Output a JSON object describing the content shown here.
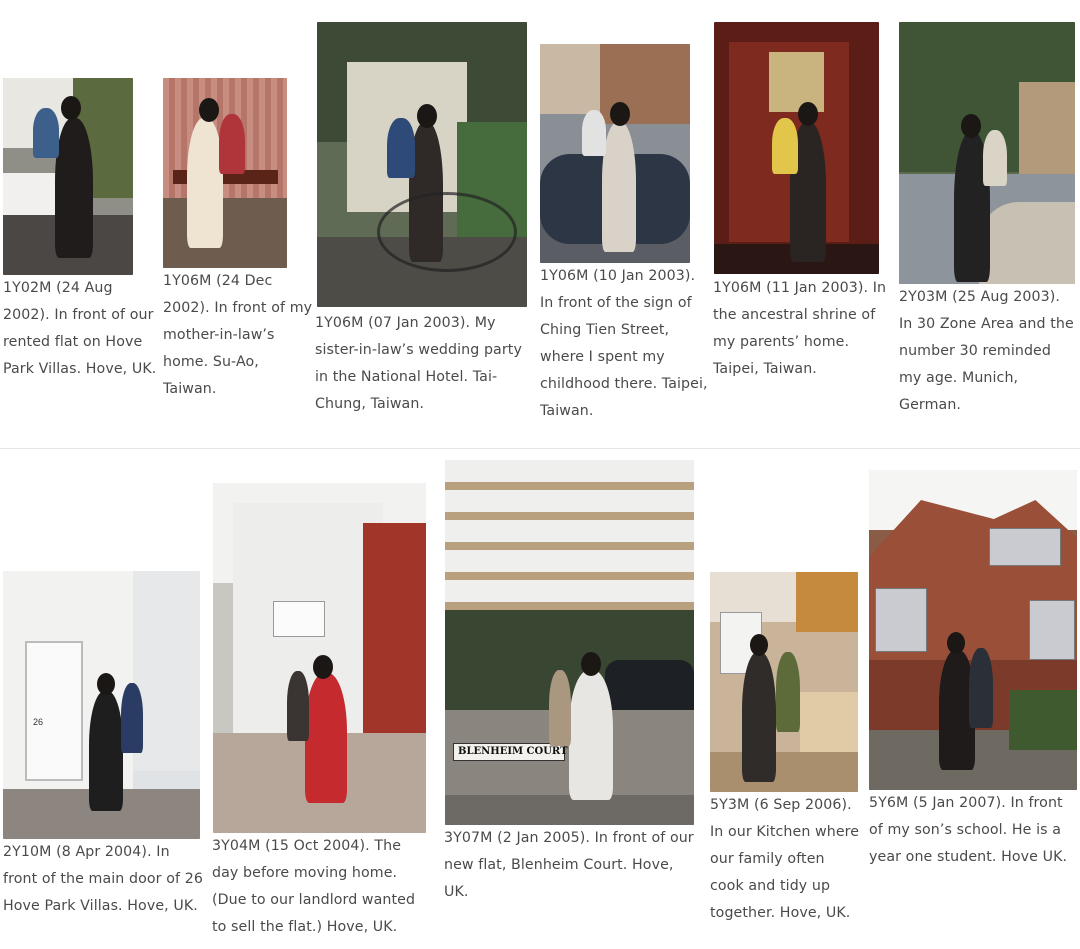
{
  "captions": [
    "1Y02M (24 Aug 2002). In front of our rented flat on Hove Park Villas. Hove, UK.",
    "1Y06M (24 Dec 2002). In front of my mother-in-law’s home. Su-Ao, Taiwan.",
    "1Y06M (07 Jan 2003). My sister-in-law’s wedding party in the National Hotel. Tai-Chung, Taiwan.",
    "1Y06M (10 Jan 2003). In front of the sign of Ching Tien Street, where I spent my childhood there. Taipei, Taiwan.",
    "1Y06M (11 Jan 2003). In the ancestral shrine of my parents’ home. Taipei, Taiwan.",
    "2Y03M (25 Aug 2003). In 30 Zone Area and the number 30 reminded my age. Munich, German.",
    "2Y10M (8 Apr 2004). In front of the main door of 26 Hove Park Villas. Hove, UK.",
    "3Y04M (15 Oct 2004). The day before moving home. (Due to our landlord wanted to sell the flat.) Hove, UK.",
    "3Y07M (2 Jan 2005). In front of our new flat, Blenheim Court. Hove, UK.",
    "5Y3M (6 Sep 2006). In our Kitchen where our family often cook and tidy up together. Hove, UK.",
    "5Y6M (5 Jan 2007). In front of my son’s school. He is a year one student. Hove UK."
  ],
  "signs": {
    "blenheim": "BLENHEIM COURT",
    "door_number": "26"
  }
}
